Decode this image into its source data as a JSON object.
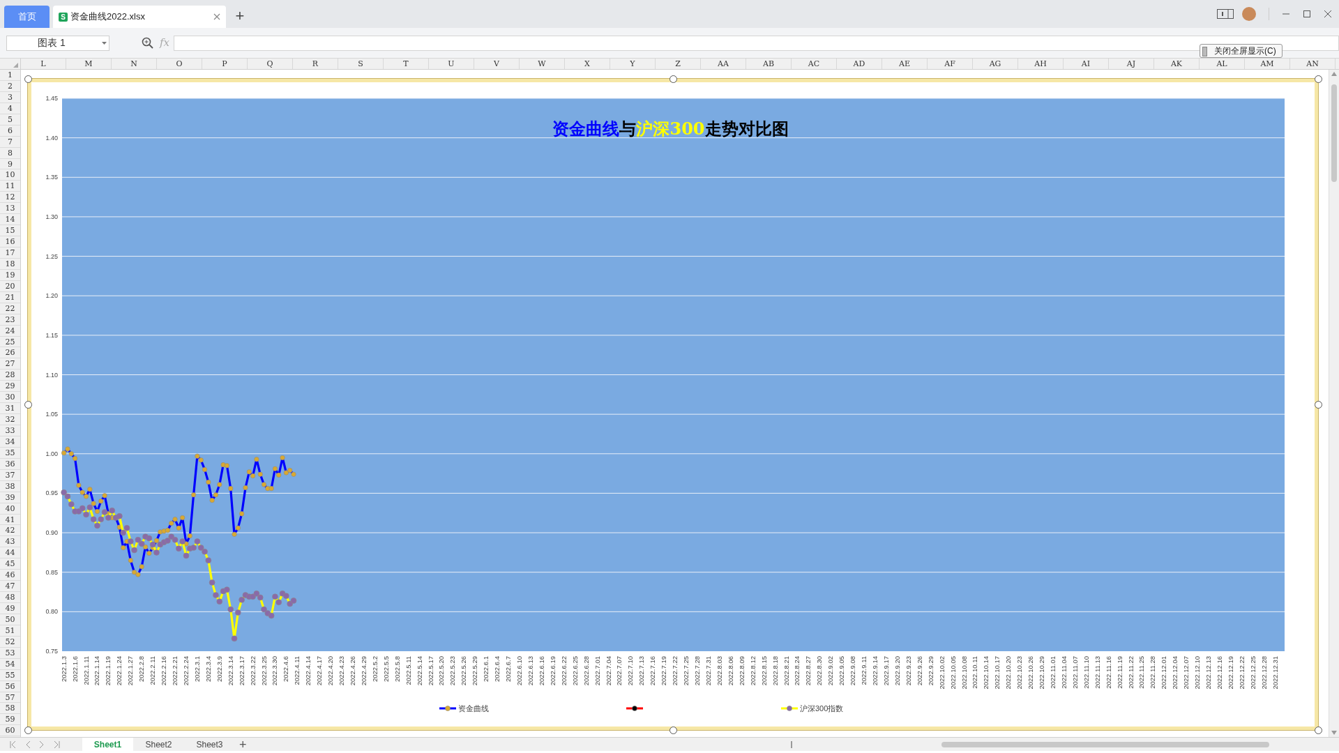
{
  "tabs": [
    {
      "label": "首页",
      "kind": "home",
      "selected": false
    },
    {
      "label": "资金曲线2022.xlsx",
      "kind": "file",
      "selected": true,
      "icon_letter": "S"
    }
  ],
  "new_tab": "+",
  "name_box": "图表 1",
  "formula_label": "fx",
  "fullscreen_button": "关闭全屏显示(C)",
  "columns": [
    "L",
    "M",
    "N",
    "O",
    "P",
    "Q",
    "R",
    "S",
    "T",
    "U",
    "V",
    "W",
    "X",
    "Y",
    "Z",
    "AA",
    "AB",
    "AC",
    "AD",
    "AE",
    "AF",
    "AG",
    "AH",
    "AI",
    "AJ",
    "AK",
    "AL",
    "AM",
    "AN"
  ],
  "rows": [
    "1",
    "2",
    "3",
    "4",
    "5",
    "6",
    "7",
    "8",
    "9",
    "10",
    "11",
    "12",
    "13",
    "14",
    "15",
    "16",
    "17",
    "18",
    "19",
    "20",
    "21",
    "22",
    "23",
    "24",
    "25",
    "26",
    "27",
    "28",
    "29",
    "30",
    "31",
    "32",
    "33",
    "34",
    "35",
    "36",
    "37",
    "38",
    "39",
    "40",
    "41",
    "42",
    "43",
    "44",
    "45",
    "46",
    "47",
    "48",
    "49",
    "50",
    "51",
    "52",
    "53",
    "54",
    "55",
    "56",
    "57",
    "58",
    "59",
    "60"
  ],
  "chart": {
    "title_parts": [
      {
        "text": "资金曲线",
        "color": "#0000ff"
      },
      {
        "text": "与",
        "color": "#000000"
      },
      {
        "text": "沪深300",
        "color": "#ffff00"
      },
      {
        "text": "走势对比图",
        "color": "#000000"
      }
    ],
    "markers": [
      {
        "color": "#d9a931"
      },
      {
        "color": "#000000"
      },
      {
        "color": "#8a6aa8"
      }
    ],
    "chart_data": {
      "type": "line",
      "grid": true,
      "legend": true,
      "categories": [
        "2022.1.3",
        null,
        null,
        "2022.1.6",
        null,
        null,
        "2022.1.11",
        null,
        null,
        "2022.1.14",
        null,
        null,
        "2022.1.19",
        null,
        null,
        "2022.1.24",
        null,
        null,
        "2022.1.27",
        null,
        null,
        "2022.2.8",
        null,
        null,
        "2022.2.11",
        null,
        null,
        "2022.2.16",
        null,
        null,
        "2022.2.21",
        null,
        null,
        "2022.2.24",
        null,
        null,
        "2022.3.1",
        null,
        null,
        "2022.3.4",
        null,
        null,
        "2022.3.9",
        null,
        null,
        "2022.3.14",
        null,
        null,
        "2022.3.17",
        null,
        null,
        "2022.3.22",
        null,
        null,
        "2022.3.25",
        null,
        null,
        "2022.3.30",
        null,
        null,
        "2022.4.6",
        null,
        null,
        "2022.4.11",
        null,
        null,
        "2022.4.14",
        null,
        null,
        "2022.4.17",
        null,
        null,
        "2022.4.20",
        null,
        null,
        "2022.4.23",
        null,
        null,
        "2022.4.26",
        null,
        null,
        "2022.4.29",
        null,
        null,
        "2022.5.2",
        null,
        null,
        "2022.5.5",
        null,
        null,
        "2022.5.8",
        null,
        null,
        "2022.5.11",
        null,
        null,
        "2022.5.14",
        null,
        null,
        "2022.5.17",
        null,
        null,
        "2022.5.20",
        null,
        null,
        "2022.5.23",
        null,
        null,
        "2022.5.26",
        null,
        null,
        "2022.5.29",
        null,
        null,
        "2022.6.1",
        null,
        null,
        "2022.6.4",
        null,
        null,
        "2022.6.7",
        null,
        null,
        "2022.6.10",
        null,
        null,
        "2022.6.13",
        null,
        null,
        "2022.6.16",
        null,
        null,
        "2022.6.19",
        null,
        null,
        "2022.6.22",
        null,
        null,
        "2022.6.25",
        null,
        null,
        "2022.6.28",
        null,
        null,
        "2022.7.01",
        null,
        null,
        "2022.7.04",
        null,
        null,
        "2022.7.07",
        null,
        null,
        "2022.7.10",
        null,
        null,
        "2022.7.13",
        null,
        null,
        "2022.7.16",
        null,
        null,
        "2022.7.19",
        null,
        null,
        "2022.7.22",
        null,
        null,
        "2022.7.25",
        null,
        null,
        "2022.7.28",
        null,
        null,
        "2022.7.31",
        null,
        null,
        "2022.8.03",
        null,
        null,
        "2022.8.06",
        null,
        null,
        "2022.8.09",
        null,
        null,
        "2022.8.12",
        null,
        null,
        "2022.8.15",
        null,
        null,
        "2022.8.18",
        null,
        null,
        "2022.8.21",
        null,
        null,
        "2022.8.24",
        null,
        null,
        "2022.8.27",
        null,
        null,
        "2022.8.30",
        null,
        null,
        "2022.9.02",
        null,
        null,
        "2022.9.05",
        null,
        null,
        "2022.9.08",
        null,
        null,
        "2022.9.11",
        null,
        null,
        "2022.9.14",
        null,
        null,
        "2022.9.17",
        null,
        null,
        "2022.9.20",
        null,
        null,
        "2022.9.23",
        null,
        null,
        "2022.9.26",
        null,
        null,
        "2022.9.29",
        null,
        null,
        "2022.10.02",
        null,
        null,
        "2022.10.05",
        null,
        null,
        "2022.10.08",
        null,
        null,
        "2022.10.11",
        null,
        null,
        "2022.10.14",
        null,
        null,
        "2022.10.17",
        null,
        null,
        "2022.10.20",
        null,
        null,
        "2022.10.23",
        null,
        null,
        "2022.10.26",
        null,
        null,
        "2022.10.29",
        null,
        null,
        "2022.11.01",
        null,
        null,
        "2022.11.04",
        null,
        null,
        "2022.11.07",
        null,
        null,
        "2022.11.10",
        null,
        null,
        "2022.11.13",
        null,
        null,
        "2022.11.16",
        null,
        null,
        "2022.11.19",
        null,
        null,
        "2022.11.22",
        null,
        null,
        "2022.11.25",
        null,
        null,
        "2022.11.28",
        null,
        null,
        "2022.12.01",
        null,
        null,
        "2022.12.04",
        null,
        null,
        "2022.12.07",
        null,
        null,
        "2022.12.10",
        null,
        null,
        "2022.12.13",
        null,
        null,
        "2022.12.16",
        null,
        null,
        "2022.12.19",
        null,
        null,
        "2022.12.22",
        null,
        null,
        "2022.12.25",
        null,
        null,
        "2022.12.28",
        null,
        null,
        "2022.12.31",
        null,
        null
      ],
      "ylim": [
        0.75,
        1.45
      ],
      "series": [
        {
          "name": "资金曲线",
          "color": "#0000ff",
          "marker": "circle",
          "values": [
            1.001,
            1.006,
            1.0,
            0.994,
            0.96,
            0.951,
            0.946,
            0.955,
            0.937,
            0.927,
            0.94,
            0.947,
            0.924,
            0.919,
            0.919,
            0.907,
            0.881,
            0.889,
            0.865,
            0.85,
            0.847,
            0.857,
            0.882,
            0.874,
            0.881,
            0.89,
            0.901,
            0.902,
            0.903,
            0.912,
            0.917,
            0.906,
            0.919,
            0.886,
            0.896,
            0.948,
            0.997,
            0.992,
            0.98,
            0.964,
            0.941,
            0.948,
            0.961,
            0.986,
            0.985,
            0.956,
            0.898,
            0.906,
            0.924,
            0.957,
            0.977,
            0.972,
            0.993,
            0.974,
            0.961,
            0.956,
            0.956,
            0.981,
            0.973,
            0.995,
            0.976,
            0.979,
            0.974,
            null,
            null,
            null,
            null,
            null,
            null,
            null,
            null,
            null,
            null,
            null,
            null,
            null,
            null,
            null,
            null,
            null,
            null,
            null,
            null,
            null,
            null,
            null,
            null,
            null,
            null,
            null,
            null,
            null,
            null,
            null,
            null,
            null,
            null,
            null,
            null,
            null,
            null,
            null,
            null,
            null,
            null,
            null,
            null,
            null,
            null,
            null,
            null,
            null,
            null,
            null,
            null,
            null,
            null,
            null,
            null,
            null,
            null,
            null,
            null,
            null,
            null,
            null,
            null,
            null,
            null,
            null,
            null,
            null,
            null,
            null,
            null,
            null,
            null,
            null,
            null,
            null,
            null,
            null,
            null,
            null,
            null,
            null,
            null,
            null,
            null,
            null,
            null,
            null,
            null,
            null,
            null,
            null,
            null,
            null,
            null,
            null,
            null,
            null,
            null,
            null,
            null,
            null,
            null,
            null,
            null,
            null,
            null,
            null,
            null,
            null,
            null,
            null,
            null,
            null,
            null,
            null,
            null,
            null,
            null,
            null,
            null,
            null,
            null,
            null,
            null,
            null,
            null,
            null,
            null,
            null,
            null,
            null,
            null,
            null,
            null,
            null,
            null,
            null,
            null,
            null,
            null,
            null,
            null,
            null,
            null,
            null,
            null,
            null,
            null,
            null,
            null,
            null,
            null,
            null,
            null,
            null,
            null,
            null,
            null,
            null,
            null,
            null,
            null,
            null,
            null,
            null,
            null,
            null,
            null,
            null,
            null,
            null,
            null,
            null,
            null,
            null,
            null,
            null,
            null,
            null,
            null,
            null,
            null,
            null,
            null,
            null,
            null,
            null,
            null,
            null,
            null,
            null,
            null,
            null,
            null,
            null,
            null,
            null,
            null,
            null,
            null,
            null,
            null,
            null,
            null,
            null,
            null,
            null,
            null,
            null,
            null,
            null,
            null,
            null,
            null,
            null,
            null,
            null,
            null,
            null,
            null,
            null,
            null,
            null,
            null,
            null,
            null,
            null,
            null,
            null,
            null,
            null,
            null,
            null,
            null,
            null,
            null,
            null,
            null,
            null,
            null,
            null,
            null,
            null,
            null,
            null,
            null,
            null,
            null,
            null,
            null,
            null,
            null,
            null,
            null,
            null,
            null,
            null,
            null,
            null,
            null,
            null,
            null,
            null,
            null,
            null
          ]
        },
        {
          "color": "#ff0000",
          "marker": "circle",
          "values": [
            null,
            null,
            null,
            null,
            null,
            null,
            null,
            null,
            null,
            null,
            null,
            null,
            null,
            null,
            null,
            null,
            null,
            null,
            null,
            null,
            null,
            null,
            null,
            null,
            null,
            null,
            null,
            null,
            null,
            null,
            null,
            null,
            null,
            null,
            null,
            null,
            null,
            null,
            null,
            null,
            null,
            null,
            null,
            null,
            null,
            null,
            null,
            null,
            null,
            null,
            null,
            null,
            null,
            null,
            null,
            null,
            null,
            null,
            null,
            null,
            null,
            null,
            null,
            null,
            null,
            null,
            null,
            null,
            null,
            null,
            null,
            null,
            null,
            null,
            null,
            null,
            null,
            null,
            null,
            null,
            null,
            null,
            null,
            null,
            null,
            null,
            null,
            null,
            null,
            null,
            null,
            null,
            null,
            null,
            null,
            null,
            null,
            null,
            null,
            null,
            null,
            null,
            null,
            null,
            null,
            null,
            null,
            null,
            null,
            null,
            null,
            null,
            null,
            null,
            null,
            null,
            null,
            null,
            null,
            null,
            null,
            null,
            null,
            null,
            null,
            null,
            null,
            null,
            null,
            null,
            null,
            null,
            null,
            null,
            null,
            null,
            null,
            null,
            null,
            null,
            null,
            null,
            null,
            null,
            null,
            null,
            null,
            null,
            null,
            null,
            null,
            null,
            null,
            null,
            null,
            null,
            null,
            null,
            null,
            null,
            null,
            null,
            null,
            null,
            null,
            null,
            null,
            null,
            null,
            null,
            null,
            null,
            null,
            null,
            null,
            null,
            null,
            null,
            null,
            null,
            null,
            null,
            null,
            null,
            null,
            null,
            null,
            null,
            null,
            null,
            null,
            null,
            null,
            null,
            null,
            null,
            null,
            null,
            null,
            null,
            null,
            null,
            null,
            null,
            null,
            null,
            null,
            null,
            null,
            null,
            null,
            null,
            null,
            null,
            null,
            null,
            null,
            null,
            null,
            null,
            null,
            null,
            null,
            null,
            null,
            null,
            null,
            null,
            null,
            null,
            null,
            null,
            null,
            null,
            null,
            null,
            null,
            null,
            null,
            null,
            null,
            null,
            null,
            null,
            null,
            null,
            null,
            null,
            null,
            null,
            null,
            null,
            null,
            null,
            null,
            null,
            null,
            null,
            null,
            null,
            null,
            null,
            null,
            null,
            null,
            null,
            null,
            null,
            null,
            null,
            null,
            null,
            null,
            null,
            null,
            null,
            null,
            null,
            null,
            null,
            null,
            null,
            null,
            null,
            null,
            null,
            null,
            null,
            null,
            null,
            null,
            null,
            null,
            null,
            null,
            null,
            null,
            null,
            null,
            null,
            null,
            null,
            null,
            null,
            null,
            null,
            null,
            null,
            null,
            null,
            null,
            null,
            null,
            null,
            null,
            null,
            null,
            null,
            null,
            null,
            null,
            null,
            null,
            null,
            null,
            null,
            null,
            null,
            null,
            null
          ]
        },
        {
          "name": "沪深300指数",
          "color": "#ffff00",
          "marker": "circle",
          "values": [
            0.951,
            0.946,
            0.936,
            0.927,
            0.927,
            0.931,
            0.923,
            0.932,
            0.917,
            0.909,
            0.917,
            0.926,
            0.919,
            0.928,
            0.919,
            0.921,
            0.9,
            0.906,
            0.889,
            0.878,
            0.891,
            0.886,
            0.895,
            0.893,
            0.885,
            0.875,
            0.885,
            0.888,
            0.89,
            0.895,
            0.891,
            0.88,
            0.889,
            0.871,
            0.88,
            0.881,
            0.889,
            0.881,
            0.876,
            0.865,
            0.837,
            0.821,
            0.813,
            0.826,
            0.828,
            0.803,
            0.766,
            0.799,
            0.815,
            0.821,
            0.819,
            0.819,
            0.823,
            0.818,
            0.803,
            0.798,
            0.795,
            0.819,
            0.812,
            0.823,
            0.82,
            0.81,
            0.814,
            null,
            null,
            null,
            null,
            null,
            null,
            null,
            null,
            null,
            null,
            null,
            null,
            null,
            null,
            null,
            null,
            null,
            null,
            null,
            null,
            null,
            null,
            null,
            null,
            null,
            null,
            null,
            null,
            null,
            null,
            null,
            null,
            null,
            null,
            null,
            null,
            null,
            null,
            null,
            null,
            null,
            null,
            null,
            null,
            null,
            null,
            null,
            null,
            null,
            null,
            null,
            null,
            null,
            null,
            null,
            null,
            null,
            null,
            null,
            null,
            null,
            null,
            null,
            null,
            null,
            null,
            null,
            null,
            null,
            null,
            null,
            null,
            null,
            null,
            null,
            null,
            null,
            null,
            null,
            null,
            null,
            null,
            null,
            null,
            null,
            null,
            null,
            null,
            null,
            null,
            null,
            null,
            null,
            null,
            null,
            null,
            null,
            null,
            null,
            null,
            null,
            null,
            null,
            null,
            null,
            null,
            null,
            null,
            null,
            null,
            null,
            null,
            null,
            null,
            null,
            null,
            null,
            null,
            null,
            null,
            null,
            null,
            null,
            null,
            null,
            null,
            null,
            null,
            null,
            null,
            null,
            null,
            null,
            null,
            null,
            null,
            null,
            null,
            null,
            null,
            null,
            null,
            null,
            null,
            null,
            null,
            null,
            null,
            null,
            null,
            null,
            null,
            null,
            null,
            null,
            null,
            null,
            null,
            null,
            null,
            null,
            null,
            null,
            null,
            null,
            null,
            null,
            null,
            null,
            null,
            null,
            null,
            null,
            null,
            null,
            null,
            null,
            null,
            null,
            null,
            null,
            null,
            null,
            null,
            null,
            null,
            null,
            null,
            null,
            null,
            null,
            null,
            null,
            null,
            null,
            null,
            null,
            null,
            null,
            null,
            null,
            null,
            null,
            null,
            null,
            null,
            null,
            null,
            null,
            null,
            null,
            null,
            null,
            null,
            null,
            null,
            null,
            null,
            null,
            null,
            null,
            null,
            null,
            null,
            null,
            null,
            null,
            null,
            null,
            null,
            null,
            null,
            null,
            null,
            null,
            null,
            null,
            null,
            null,
            null,
            null,
            null,
            null,
            null,
            null,
            null,
            null,
            null,
            null,
            null,
            null,
            null,
            null,
            null,
            null,
            null,
            null,
            null,
            null,
            null,
            null,
            null,
            null,
            null,
            null,
            null,
            null
          ]
        }
      ],
      "yticks": [
        {
          "value": 0.75,
          "label": "0.75"
        },
        {
          "value": 0.8,
          "label": "0.80"
        },
        {
          "value": 0.85,
          "label": "0.85"
        },
        {
          "value": 0.9,
          "label": "0.90"
        },
        {
          "value": 0.95,
          "label": "0.95"
        },
        {
          "value": 1.0,
          "label": "1.00"
        },
        {
          "value": 1.05,
          "label": "1.05"
        },
        {
          "value": 1.1,
          "label": "1.10"
        },
        {
          "value": 1.15,
          "label": "1.15"
        },
        {
          "value": 1.2,
          "label": "1.20"
        },
        {
          "value": 1.25,
          "label": "1.25"
        },
        {
          "value": 1.3,
          "label": "1.30"
        },
        {
          "value": 1.35,
          "label": "1.35"
        },
        {
          "value": 1.4,
          "label": "1.40"
        },
        {
          "value": 1.45,
          "label": "1.45"
        }
      ]
    }
  },
  "sheets": [
    {
      "label": "Sheet1",
      "selected": true
    },
    {
      "label": "Sheet2",
      "selected": false
    },
    {
      "label": "Sheet3",
      "selected": false
    }
  ],
  "add_sheet": "+"
}
